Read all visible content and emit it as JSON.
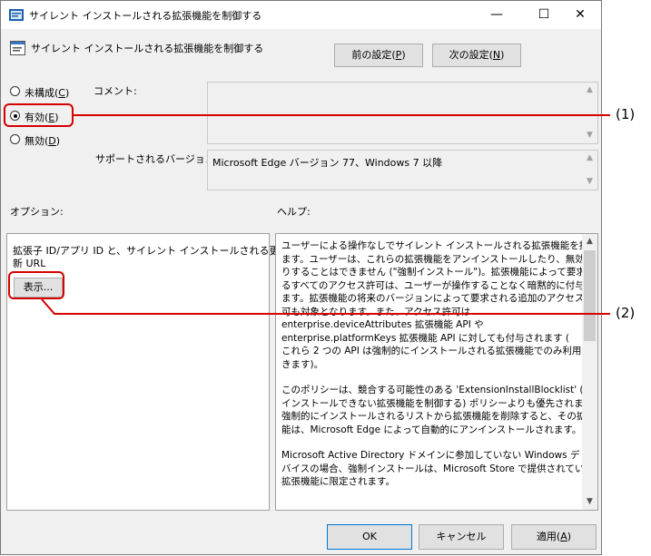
{
  "window": {
    "title": "サイレント インストールされる拡張機能を制御する",
    "minimize": "—",
    "maximize": "☐",
    "close": "✕"
  },
  "header": {
    "policy_name": "サイレント インストールされる拡張機能を制御する"
  },
  "nav": {
    "prev_label": "前の設定(",
    "prev_key": "P",
    "next_label": "次の設定(",
    "next_key": "N",
    "close_paren": ")"
  },
  "radios": {
    "not_configured": "未構成(",
    "not_configured_key": "C",
    "enabled": "有効(",
    "enabled_key": "E",
    "disabled": "無効(",
    "disabled_key": "D",
    "close_paren": ")",
    "selected": "enabled"
  },
  "comment": {
    "label": "コメント:",
    "value": ""
  },
  "supported": {
    "label": "サポートされるバージョン:",
    "value": "Microsoft Edge バージョン 77、Windows 7 以降"
  },
  "options": {
    "label": "オプション:",
    "description_line1": "拡張子 ID/アプリ ID と、サイレント インストールされる更",
    "description_line2": "新 URL",
    "show_button": "表示..."
  },
  "help": {
    "label": "ヘルプ:",
    "lines_p1": [
      "ユーザーによる操作なしでサイレント インストールされる拡張機能を指定し",
      "ます。ユーザーは、これらの拡張機能をアンインストールしたり、無効にした",
      "りすることはできません (\"強制インストール\")。拡張機能によって要求され",
      "るすべてのアクセス許可は、ユーザーが操作することなく暗黙的に付与され",
      "ます。拡張機能の将来のバージョンによって要求される追加のアクセス許",
      "可も対象となります。また、アクセス許可は",
      "enterprise.deviceAttributes 拡張機能 API や",
      "enterprise.platformKeys 拡張機能 API に対しても付与されます (",
      "これら 2 つの API は強制的にインストールされる拡張機能でのみ利用で",
      "きます)。"
    ],
    "lines_p2": [
      "このポリシーは、競合する可能性のある 'ExtensionInstallBlocklist' (",
      "インストールできない拡張機能を制御する) ポリシーよりも優先されます。",
      "強制的にインストールされるリストから拡張機能を削除すると、その拡張機",
      "能は、Microsoft Edge によって自動的にアンインストールされます。"
    ],
    "lines_p3": [
      "Microsoft Active Directory ドメインに参加していない Windows デ",
      "バイスの場合、強制インストールは、Microsoft Store で提供されている",
      "拡張機能に限定されます。"
    ]
  },
  "footer": {
    "ok": "OK",
    "cancel": "キャンセル",
    "apply_label": "適用(",
    "apply_key": "A",
    "close_paren": ")"
  },
  "callouts": {
    "one": "(1)",
    "two": "(2)"
  },
  "icons": {
    "window_icon": "policy-icon",
    "header_icon": "policy-page-icon"
  },
  "colors": {
    "callout": "#d50000",
    "window_bg": "#f0f0f0",
    "button_bg": "#e1e1e1"
  }
}
